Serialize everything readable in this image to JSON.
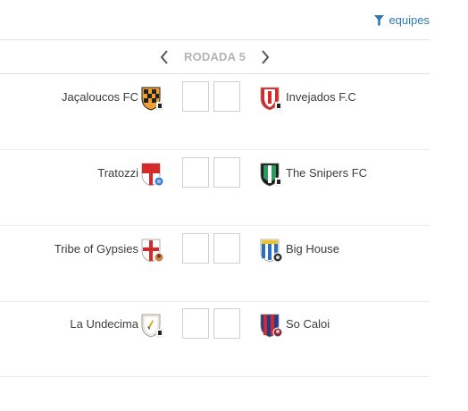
{
  "filter": {
    "label": "equipes",
    "icon": "funnel-icon",
    "color": "#2d77b5"
  },
  "round": {
    "title": "RODADA 5",
    "prev_icon": "chevron-left-icon",
    "next_icon": "chevron-right-icon"
  },
  "matches": [
    {
      "home": "Jaçaloucos FC",
      "away": "Invejados F.C",
      "home_score": "",
      "away_score": ""
    },
    {
      "home": "Tratozzi",
      "away": "The Snipers FC",
      "home_score": "",
      "away_score": ""
    },
    {
      "home": "Tribe of Gypsies",
      "away": "Big House",
      "home_score": "",
      "away_score": ""
    },
    {
      "home": "La Undecima",
      "away": "So Caloi",
      "home_score": "",
      "away_score": ""
    }
  ]
}
